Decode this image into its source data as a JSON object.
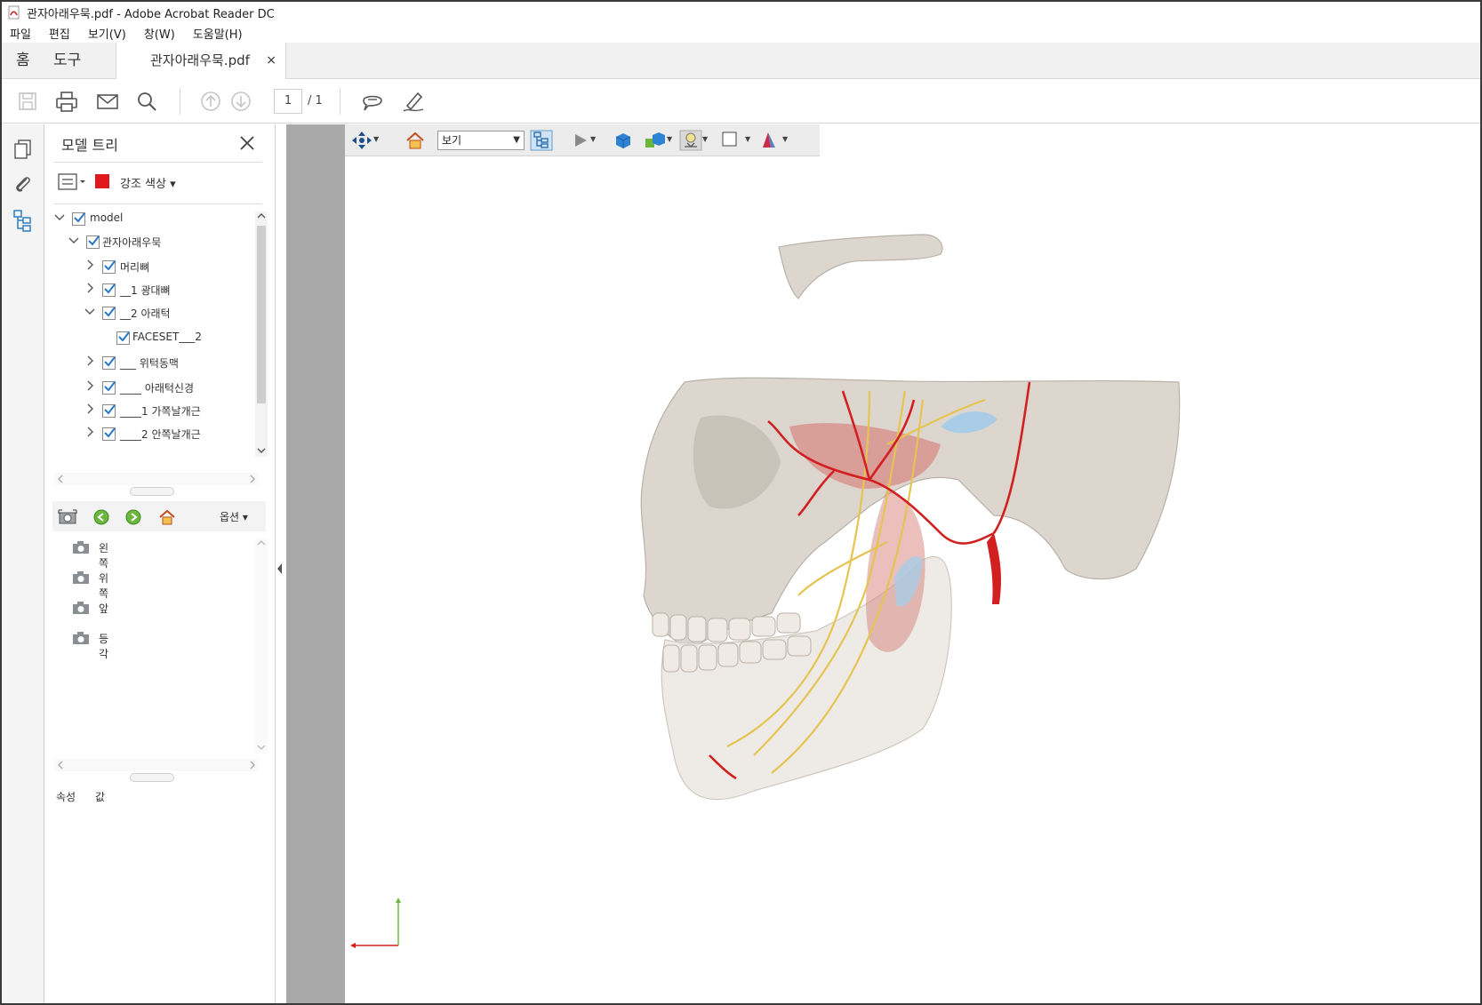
{
  "window": {
    "title": "관자아래우묵.pdf - Adobe Acrobat Reader DC"
  },
  "menu": [
    "파일",
    "편집",
    "보기(V)",
    "창(W)",
    "도움말(H)"
  ],
  "tabs": {
    "home": "홈",
    "tools": "도구",
    "document": "관자아래우묵.pdf",
    "close": "×"
  },
  "toolbar": {
    "page_current": "1",
    "page_total": "/ 1"
  },
  "panel": {
    "title": "모델 트리",
    "highlight_color_label": "강조 색상",
    "highlight_color": "#e0191f",
    "tree": [
      {
        "label": "model",
        "level": 0,
        "expanded": true
      },
      {
        "label": "관자아래우묵",
        "level": 1,
        "expanded": true
      },
      {
        "label": "머리뼈",
        "level": 2,
        "expanded": false
      },
      {
        "label": "__1 광대뼈",
        "level": 2,
        "expanded": false
      },
      {
        "label": "__2 아래턱",
        "level": 2,
        "expanded": true
      },
      {
        "label": "FACESET___2",
        "level": 3,
        "expanded": null
      },
      {
        "label": "___ 위턱동맥",
        "level": 2,
        "expanded": false
      },
      {
        "label": "____ 아래턱신경",
        "level": 2,
        "expanded": false
      },
      {
        "label": "____1 가쪽날개근",
        "level": 2,
        "expanded": false
      },
      {
        "label": "____2 안쪽날개근",
        "level": 2,
        "expanded": false
      }
    ],
    "views_options_label": "옵션",
    "views": [
      "왼쪽",
      "위쪽",
      "앞",
      "등각"
    ],
    "properties": {
      "name_col": "속성",
      "value_col": "값"
    }
  },
  "toolbar3d": {
    "views_select": "보기"
  },
  "colors": {
    "bone": "#dcd6cf",
    "artery": "#d21f1f",
    "nerve": "#e6c452",
    "muscle": "#d98b85",
    "cartilage": "#a9cde6"
  }
}
